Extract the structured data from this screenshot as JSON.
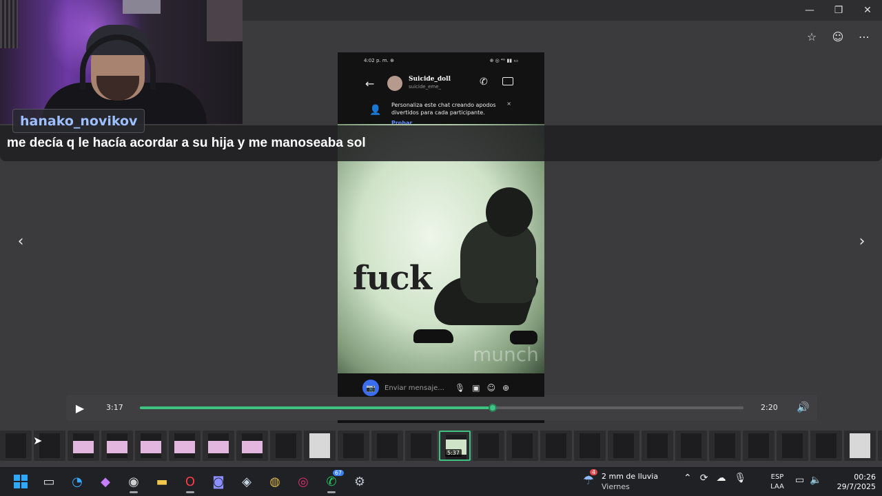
{
  "window": {
    "controls": {
      "minimize": "—",
      "restore": "❐",
      "close": "✕"
    }
  },
  "viewer_actions": {
    "favorite": "☆",
    "feedback": "☺",
    "more": "⋯"
  },
  "stream": {
    "username": "hanako_novikov",
    "caption": "me decía q le hacía acordar a su hija y me manoseaba sol"
  },
  "phone": {
    "status_time": "4:02 p. m. ⊕",
    "status_icons": "⊕ ◎ ⁴ᴳ ▮▮ ▭",
    "back": "←",
    "contact_name": "Suicide_doll",
    "contact_handle": "suicide_eme_",
    "call_icon": "✆",
    "banner_icon": "👤",
    "banner_text": "Personaliza este chat creando apodos divertidos para cada participante.",
    "banner_close": "×",
    "banner_link": "Probar",
    "image_text": "fuck",
    "image_watermark": "munch",
    "input_placeholder": "Enviar mensaje...",
    "camera_icon": "📷",
    "mic_icon": "🎙",
    "gallery_icon": "▣",
    "sticker_icon": "☺",
    "plus_icon": "⊕"
  },
  "nav": {
    "prev": "‹",
    "next": "›"
  },
  "player": {
    "play_icon": "▶",
    "current_time": "3:17",
    "duration": "2:20",
    "progress": 0.585,
    "volume_icon": "🔊"
  },
  "filmstrip": {
    "thumbs": [
      "dark",
      "dark",
      "pink",
      "pink",
      "pink",
      "pink",
      "pink",
      "pink",
      "dark",
      "light",
      "dark",
      "dark",
      "dark",
      "sel",
      "dark",
      "dark",
      "dark",
      "dark",
      "dark",
      "dark",
      "dark",
      "dark",
      "dark",
      "dark",
      "dark",
      "light",
      "light",
      "pink"
    ],
    "selected_index": 13,
    "selected_time": "5:37"
  },
  "taskbar": {
    "apps": [
      {
        "name": "start",
        "icon": ""
      },
      {
        "name": "task-view",
        "icon": "▭"
      },
      {
        "name": "edge",
        "icon": "◔"
      },
      {
        "name": "copilot",
        "icon": "◆"
      },
      {
        "name": "chrome",
        "icon": "◉"
      },
      {
        "name": "file-explorer",
        "icon": "▬"
      },
      {
        "name": "opera",
        "icon": "O"
      },
      {
        "name": "discord",
        "icon": "◙"
      },
      {
        "name": "steam",
        "icon": "◈"
      },
      {
        "name": "app-yellow",
        "icon": "◍"
      },
      {
        "name": "instagram",
        "icon": "◎"
      },
      {
        "name": "whatsapp",
        "icon": "✆",
        "badge": "67"
      },
      {
        "name": "settings",
        "icon": "⚙"
      }
    ],
    "weather": {
      "badge": "4",
      "line1": "2 mm de lluvia",
      "line2": "Viernes",
      "icon": "☂"
    },
    "tray": {
      "chevron": "⌃",
      "sync": "⟳",
      "cloud": "☁",
      "mic": "🎙"
    },
    "lang": {
      "line1": "ESP",
      "line2": "LAA"
    },
    "tray2": {
      "display": "▭",
      "volume": "🔈"
    },
    "clock": {
      "time": "00:26",
      "date": "29/7/2025"
    }
  }
}
